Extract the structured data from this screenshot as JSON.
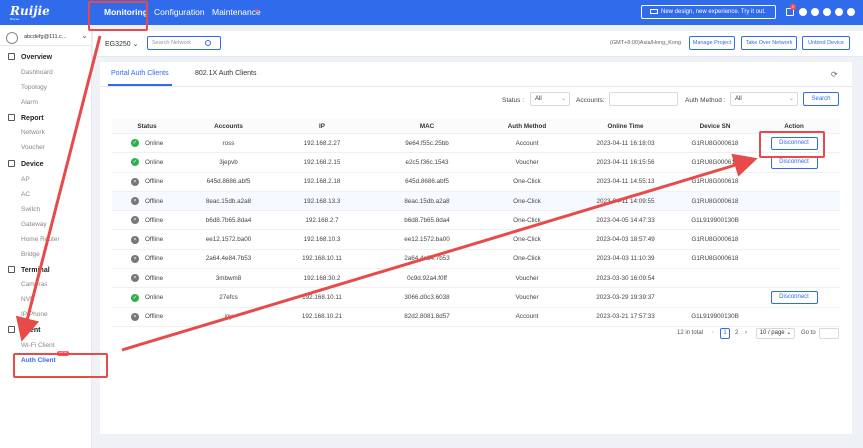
{
  "topbar": {
    "logo": "Ruijie",
    "logo_sub": "Reyee",
    "nav": [
      "Monitoring",
      "Configuration",
      "Maintenance"
    ],
    "promo": "New design, new experience. Try it out.",
    "notify_count": "2",
    "icons": [
      "notification-icon",
      "settings-icon",
      "globe-icon",
      "help-icon",
      "user-icon",
      "logout-icon"
    ]
  },
  "sidebar": {
    "user": "abcdefg@111.c...",
    "sections": [
      {
        "label": "Overview",
        "icon": "overview-icon",
        "items": [
          "Dashboard",
          "Topology",
          "Alarm"
        ]
      },
      {
        "label": "Report",
        "icon": "report-icon",
        "items": [
          "Network",
          "Voucher"
        ]
      },
      {
        "label": "Device",
        "icon": "device-icon",
        "items": [
          "AP",
          "AC",
          "Switch",
          "Gateway",
          "Home Router",
          "Bridge"
        ]
      },
      {
        "label": "Terminal",
        "icon": "terminal-icon",
        "items": [
          "Cameras",
          "NVR",
          "IP Phone"
        ]
      },
      {
        "label": "Client",
        "icon": "client-icon",
        "items": [
          "Wi-Fi Client",
          "Auth Client"
        ]
      }
    ],
    "new_badge": "NEW"
  },
  "header": {
    "device": "EG3250",
    "search_placeholder": "Search Network",
    "timezone": "(GMT+8:00)Asia/Hong_Kong",
    "buttons": [
      "Manage Project",
      "Take Over Network",
      "Unbind Device"
    ]
  },
  "tabs": [
    "Portal Auth Clients",
    "802.1X Auth Clients"
  ],
  "filters": {
    "status_label": "Status :",
    "status_value": "All",
    "accounts_label": "Accounts:",
    "auth_label": "Auth Method :",
    "auth_value": "All",
    "search": "Search"
  },
  "table": {
    "columns": [
      "Status",
      "Accounts",
      "IP",
      "MAC",
      "Auth Method",
      "Online Time",
      "Device SN",
      "Action"
    ],
    "rows": [
      {
        "status": "Online",
        "account": "ross",
        "ip": "192.168.2.27",
        "mac": "9e64.f55c.25bb",
        "method": "Account",
        "time": "2023-04-11 16:18:03",
        "sn": "G1RU8G000618",
        "action": "Disconnect"
      },
      {
        "status": "Online",
        "account": "3jepvb",
        "ip": "192.168.2.15",
        "mac": "e2c5.f36c.1543",
        "method": "Voucher",
        "time": "2023-04-11 16:15:56",
        "sn": "G1RU8G000618",
        "action": "Disconnect"
      },
      {
        "status": "Offline",
        "account": "645d.8686.abf5",
        "ip": "192.168.2.18",
        "mac": "645d.8686.abf5",
        "method": "One-Click",
        "time": "2023-04-11 14:55:13",
        "sn": "G1RU8G000618",
        "action": ""
      },
      {
        "status": "Offline",
        "account": "8eac.15db.a2a8",
        "ip": "192.168.13.3",
        "mac": "8eac.15db.a2a8",
        "method": "One-Click",
        "time": "2023-04-11 14:09:55",
        "sn": "G1RU8G000618",
        "action": ""
      },
      {
        "status": "Offline",
        "account": "b6d8.7b65.8da4",
        "ip": "192.168.2.7",
        "mac": "b6d8.7b65.8da4",
        "method": "One-Click",
        "time": "2023-04-05 14:47:33",
        "sn": "G1L919900130B",
        "action": ""
      },
      {
        "status": "Offline",
        "account": "ee12.1572.ba00",
        "ip": "192.168.10.3",
        "mac": "ee12.1572.ba00",
        "method": "One-Click",
        "time": "2023-04-03 18:57:49",
        "sn": "G1RU8G000618",
        "action": ""
      },
      {
        "status": "Offline",
        "account": "2a64.4e84.7b53",
        "ip": "192.168.10.11",
        "mac": "2a64.4e84.7b53",
        "method": "One-Click",
        "time": "2023-04-03 11:10:39",
        "sn": "G1RU8G000618",
        "action": ""
      },
      {
        "status": "Offline",
        "account": "3mbwm8",
        "ip": "192.168.30.2",
        "mac": "0c9d.92a4.f0ff",
        "method": "Voucher",
        "time": "2023-03-30 16:09:54",
        "sn": "",
        "action": ""
      },
      {
        "status": "Online",
        "account": "27efcs",
        "ip": "192.168.10.11",
        "mac": "3066.d0c3.6038",
        "method": "Voucher",
        "time": "2023-03-29 19:39:37",
        "sn": "",
        "action": "Disconnect"
      },
      {
        "status": "Offline",
        "account": "joy",
        "ip": "192.168.10.21",
        "mac": "82d2.8081.8d57",
        "method": "Account",
        "time": "2023-03-21 17:57:33",
        "sn": "G1L919900130B",
        "action": ""
      }
    ]
  },
  "pagination": {
    "total": "12 in total",
    "pages": [
      "1",
      "2"
    ],
    "page_size": "10 / page",
    "goto": "Go to"
  },
  "annotation_color": "#e84a4a"
}
